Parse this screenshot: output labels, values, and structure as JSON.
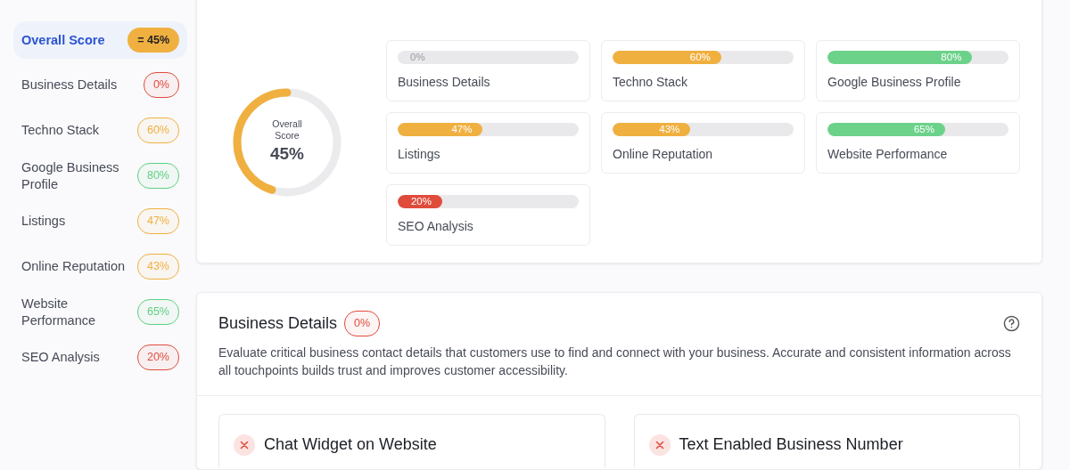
{
  "sidebar": {
    "items": [
      {
        "label": "Overall Score",
        "score": "= 45%",
        "color": "#f0b040",
        "selected": true
      },
      {
        "label": "Business Details",
        "score": "0%",
        "color": "#e04c3c",
        "selected": false
      },
      {
        "label": "Techno Stack",
        "score": "60%",
        "color": "#f0b040",
        "selected": false
      },
      {
        "label": "Google Business Profile",
        "score": "80%",
        "color": "#5fcf80",
        "selected": false
      },
      {
        "label": "Listings",
        "score": "47%",
        "color": "#f0b040",
        "selected": false
      },
      {
        "label": "Online Reputation",
        "score": "43%",
        "color": "#f0b040",
        "selected": false
      },
      {
        "label": "Website Performance",
        "score": "65%",
        "color": "#5fcf80",
        "selected": false
      },
      {
        "label": "SEO Analysis",
        "score": "20%",
        "color": "#e04c3c",
        "selected": false
      }
    ]
  },
  "overview": {
    "gauge": {
      "label": "Overall Score",
      "value": "45%",
      "level": 0.45,
      "color": "#f0b040"
    },
    "categories": [
      {
        "label": "Business Details",
        "reading": "0%",
        "level": 0
      },
      {
        "label": "Techno Stack",
        "reading": "60%",
        "level": 0.6,
        "color": "#f0b040"
      },
      {
        "label": "Google Business Profile",
        "reading": "80%",
        "level": 0.8,
        "color": "#6cd28a"
      },
      {
        "label": "Listings",
        "reading": "47%",
        "level": 0.47,
        "color": "#f0b040"
      },
      {
        "label": "Online Reputation",
        "reading": "43%",
        "level": 0.43,
        "color": "#f0b040"
      },
      {
        "label": "Website Performance",
        "reading": "65%",
        "level": 0.65,
        "color": "#6cd28a"
      },
      {
        "label": "SEO Analysis",
        "reading": "20%",
        "level": 0.2,
        "color": "#e04c3c"
      }
    ]
  },
  "section": {
    "title": "Business Details",
    "badge": {
      "text": "0%",
      "color": "#e04c3c"
    },
    "description": "Evaluate critical business contact details that customers use to find and connect with your business. Accurate and consistent information across all touchpoints builds trust and improves customer accessibility.",
    "checks": [
      {
        "title": "Chat Widget on Website",
        "passed": false
      },
      {
        "title": "Text Enabled Business Number",
        "passed": false
      }
    ]
  }
}
